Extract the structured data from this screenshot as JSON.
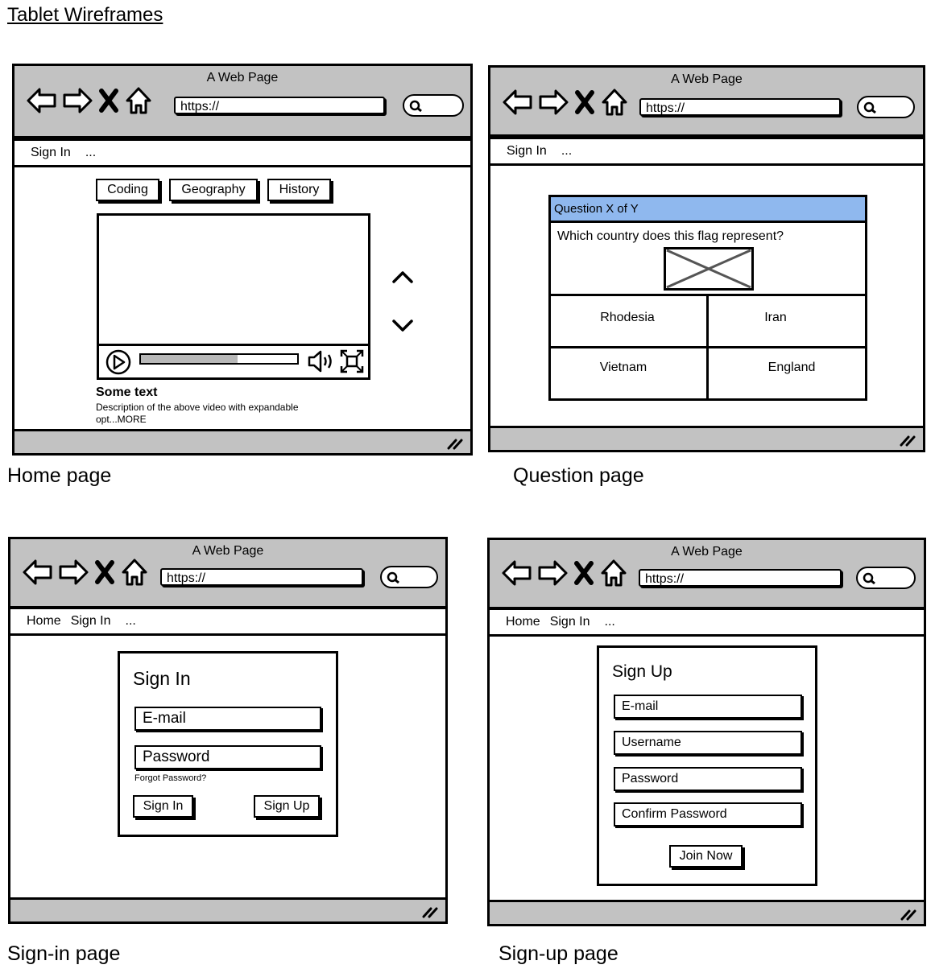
{
  "document_title": "Tablet Wireframes",
  "captions": {
    "home": "Home page",
    "question": "Question page",
    "signin": "Sign-in page",
    "signup": "Sign-up page"
  },
  "browser": {
    "window_title": "A Web Page",
    "url": "https://",
    "menu_more": "..."
  },
  "home": {
    "menu": [
      "Sign In"
    ],
    "tabs": [
      "Coding",
      "Geography",
      "History"
    ],
    "video": {
      "progress": 0.62
    },
    "text_title": "Some text",
    "description": "Description of the above video with expandable opt...MORE"
  },
  "question": {
    "menu": [
      "Sign In"
    ],
    "header": "Question X of Y",
    "prompt": "Which country does this flag represent?",
    "answers": [
      "Rhodesia",
      "Iran",
      "Vietnam",
      "England"
    ]
  },
  "signin": {
    "menu": [
      "Home",
      "Sign In"
    ],
    "heading": "Sign In",
    "email": "E-mail",
    "password": "Password",
    "forgot": "Forgot Password?",
    "signin_button": "Sign In",
    "signup_button": "Sign Up"
  },
  "signup": {
    "menu": [
      "Home",
      "Sign In"
    ],
    "heading": "Sign Up",
    "email": "E-mail",
    "username": "Username",
    "password": "Password",
    "confirm": "Confirm Password",
    "join_button": "Join Now"
  },
  "colors": {
    "chrome_gray": "#c2c2c2",
    "question_header": "#8fb8ee",
    "progress_fill": "#b8b8b8"
  }
}
